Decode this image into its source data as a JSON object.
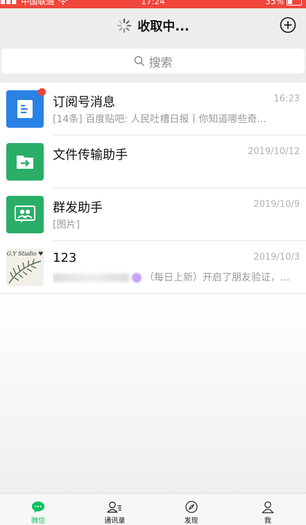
{
  "statusbar": {
    "carrier": "中国联通",
    "time": "17:24",
    "battery": "35%"
  },
  "navbar": {
    "title": "收取中..."
  },
  "search": {
    "placeholder": "搜索"
  },
  "chats": [
    {
      "name": "订阅号消息",
      "time": "16:23",
      "preview": "[14条] 百度贴吧: 人民吐槽日报丨你知道哪些奇...",
      "unread_dot": true,
      "avatar": "subscription-icon",
      "color": "#2a82e4"
    },
    {
      "name": "文件传输助手",
      "time": "2019/10/12",
      "preview": "",
      "avatar": "file-transfer-icon",
      "color": "#2aae67"
    },
    {
      "name": "群发助手",
      "time": "2019/10/9",
      "preview": "[图片]",
      "avatar": "group-send-icon",
      "color": "#2aae67"
    },
    {
      "name": "123",
      "time": "2019/10/3",
      "preview": "（每日上新）开启了朋友验证，...",
      "avatar_text": "G.Y Studio ♥"
    }
  ],
  "tabs": [
    {
      "label": "微信",
      "icon": "chat-icon",
      "active": true
    },
    {
      "label": "通讯录",
      "icon": "contacts-icon",
      "active": false
    },
    {
      "label": "发现",
      "icon": "compass-icon",
      "active": false
    },
    {
      "label": "我",
      "icon": "person-icon",
      "active": false
    }
  ],
  "colors": {
    "status_bar": "#f0463c",
    "accent": "#07c160",
    "unread": "#f44336"
  }
}
